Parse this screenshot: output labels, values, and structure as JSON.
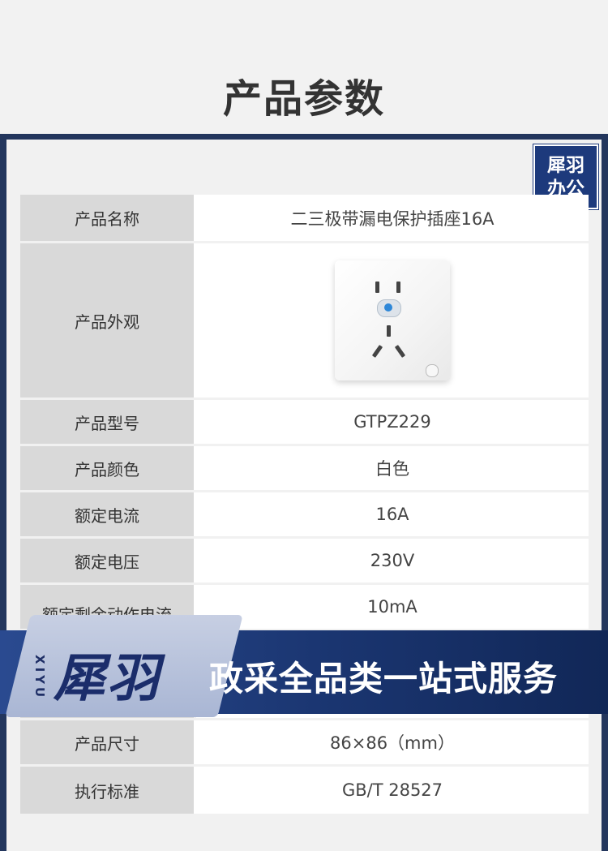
{
  "page_title": "产品参数",
  "stamp": {
    "line1": "犀羽",
    "line2": "办公"
  },
  "rows": [
    {
      "label": "产品名称",
      "value": "二三极带漏电保护插座16A"
    },
    {
      "label": "产品外观",
      "value": ""
    },
    {
      "label": "产品型号",
      "value": "GTPZ229"
    },
    {
      "label": "产品颜色",
      "value": "白色"
    },
    {
      "label": "额定电流",
      "value": "16A"
    },
    {
      "label": "额定电压",
      "value": "230V"
    },
    {
      "label": "额定剩余动作电流",
      "value": "10mA"
    },
    {
      "label": "产品尺寸",
      "value": "86×86（mm）"
    },
    {
      "label": "执行标准",
      "value": "GB/T 28527"
    }
  ],
  "banner": {
    "brand_latin": "XIYU",
    "brand_cn": "犀羽",
    "slogan": "政采全品类一站式服务"
  },
  "colors": {
    "frame": "#23365d",
    "label_bg": "#d9d9d9",
    "banner_dark": "#1a3570",
    "banner_light": "#b8c3dc"
  }
}
